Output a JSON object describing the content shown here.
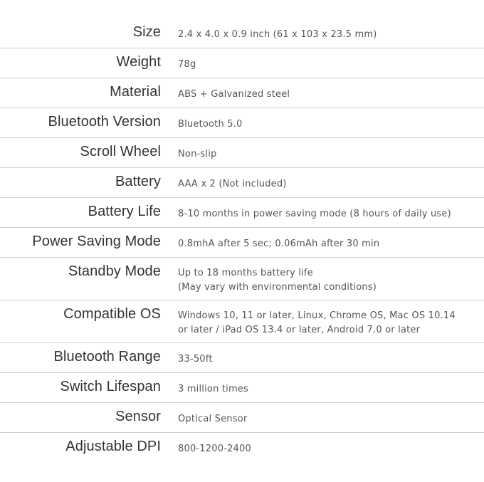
{
  "specs": [
    {
      "label": "Size",
      "value": "2.4 x 4.0 x 0.9 inch (61 x 103 x 23.5 mm)"
    },
    {
      "label": "Weight",
      "value": "78g"
    },
    {
      "label": "Material",
      "value": "ABS + Galvanized steel"
    },
    {
      "label": "Bluetooth Version",
      "value": "Bluetooth 5.0"
    },
    {
      "label": "Scroll Wheel",
      "value": "Non-slip"
    },
    {
      "label": "Battery",
      "value": "AAA x 2 (Not included)"
    },
    {
      "label": "Battery Life",
      "value": "8-10 months in power saving mode (8 hours of daily use)"
    },
    {
      "label": "Power Saving Mode",
      "value": "0.8mhA after 5 sec; 0.06mAh after 30 min"
    },
    {
      "label": "Standby Mode",
      "value": "Up to 18 months battery life\n(May vary with environmental conditions)"
    },
    {
      "label": "Compatible OS",
      "value": "Windows 10, 11 or later, Linux, Chrome OS, Mac OS 10.14\nor later / iPad OS 13.4 or later, Android 7.0 or later"
    },
    {
      "label": "Bluetooth Range",
      "value": "33-50ft"
    },
    {
      "label": "Switch Lifespan",
      "value": "3 million times"
    },
    {
      "label": "Sensor",
      "value": "Optical Sensor"
    },
    {
      "label": "Adjustable DPI",
      "value": "800-1200-2400"
    }
  ]
}
